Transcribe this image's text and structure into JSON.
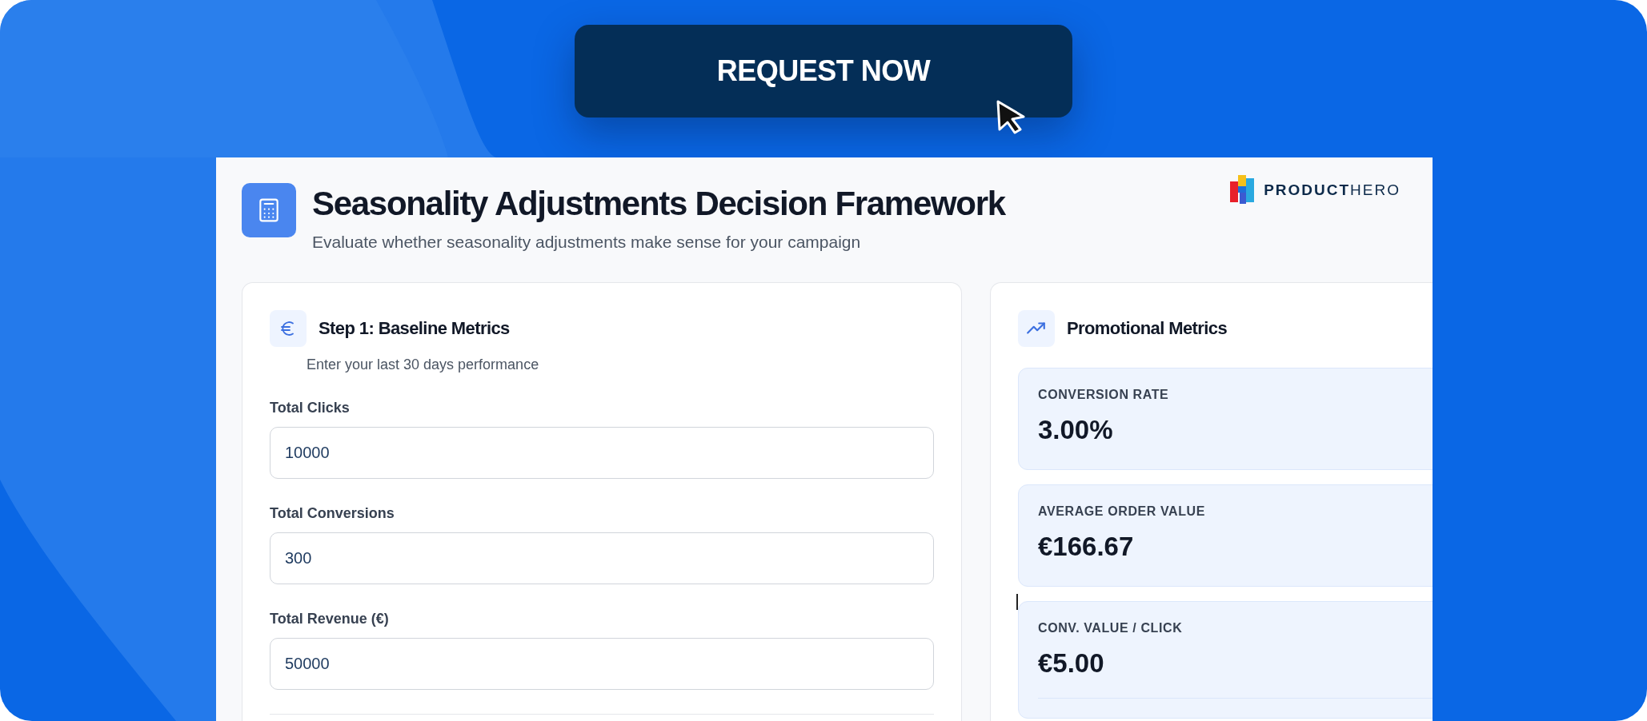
{
  "cta": {
    "label": "REQUEST NOW"
  },
  "header": {
    "title": "Seasonality Adjustments Decision Framework",
    "subtitle": "Evaluate whether seasonality adjustments make sense for your campaign",
    "logo": "**PRODUCT**HERO"
  },
  "baseline": {
    "title": "Step 1: Baseline Metrics",
    "subtitle": "Enter your last 30 days performance",
    "fields": [
      {
        "label": "Total Clicks",
        "value": "10000"
      },
      {
        "label": "Total Conversions",
        "value": "300"
      },
      {
        "label": "Total Revenue (€)",
        "value": "50000"
      }
    ]
  },
  "promo": {
    "title": "Promotional Metrics",
    "metrics": [
      {
        "label": "CONVERSION RATE",
        "value": "3.00%"
      },
      {
        "label": "AVERAGE ORDER VALUE",
        "value": "€166.67"
      },
      {
        "label": "CONV. VALUE / CLICK",
        "value": "€5.00"
      }
    ]
  }
}
